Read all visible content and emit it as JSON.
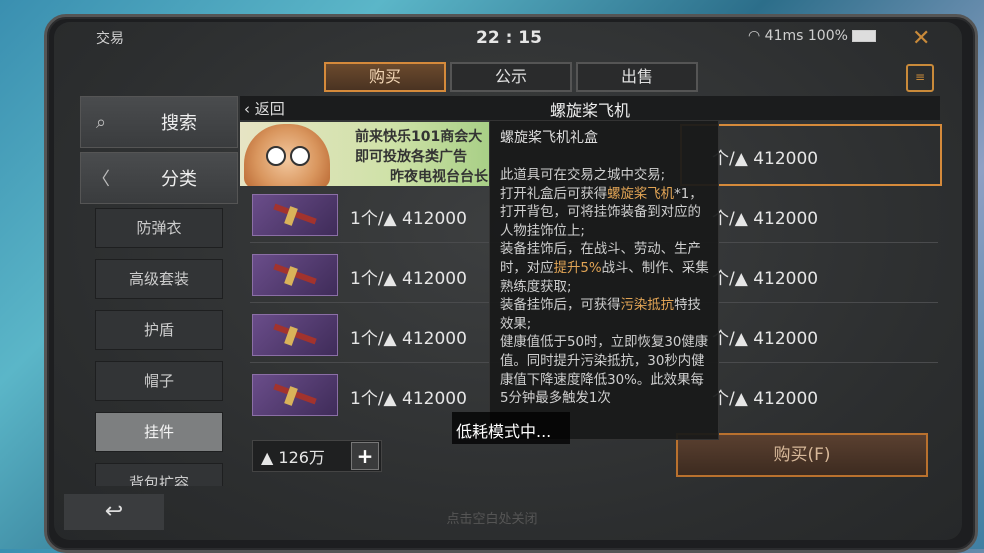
{
  "status": {
    "section_label": "交易",
    "time": "22 : 15",
    "ping": "41ms",
    "battery": "100%",
    "close_icon": "close-icon"
  },
  "tabs": [
    {
      "label": "购买",
      "active": true
    },
    {
      "label": "公示",
      "active": false
    },
    {
      "label": "出售",
      "active": false
    }
  ],
  "sidebar": {
    "search_label": "搜索",
    "category_label": "分类",
    "categories": [
      "防弹衣",
      "高级套装",
      "护盾",
      "帽子",
      "挂件",
      "背包扩容"
    ],
    "selected_category": "挂件"
  },
  "header": {
    "back_label": "返回",
    "title": "螺旋桨飞机"
  },
  "ad": {
    "line1": "前来快乐101商会大",
    "line2": "即可投放各类广告",
    "line3": "昨夜电视台台长"
  },
  "listings": [
    {
      "price": "1个/▲ 412000"
    },
    {
      "price": "1个/▲ 412000"
    },
    {
      "price": "1个/▲ 412000"
    },
    {
      "price": "1个/▲ 412000"
    },
    {
      "price": "1个/▲ 412000"
    }
  ],
  "right_prices": [
    "个/▲ 412000",
    "个/▲ 412000",
    "个/▲ 412000",
    "个/▲ 412000",
    "个/▲ 412000"
  ],
  "currency": {
    "amount": "126万",
    "plus_label": "+"
  },
  "buy_button": "购买(F)",
  "back_button_icon": "undo-icon",
  "close_hint": "点击空白处关闭",
  "tooltip": {
    "title": "螺旋桨飞机礼盒",
    "body": [
      {
        "t": "此道具可在交易之城中交易;"
      },
      {
        "t": "打开礼盒后可获得"
      },
      {
        "t": "螺旋桨飞机",
        "hl": true
      },
      {
        "t": "*1，打开背包，可将挂饰装备到对应的人物挂饰位上;"
      },
      {
        "t": "装备挂饰后，在战斗、劳动、生产时，对应"
      },
      {
        "t": "提升5%",
        "hl": true
      },
      {
        "t": "战斗、制作、采集熟练度获取;"
      },
      {
        "t": "装备挂饰后，可获得"
      },
      {
        "t": "污染抵抗",
        "hl": true
      },
      {
        "t": "特技效果;"
      },
      {
        "t": "健康值低于50时，立即恢复30健康值。同时提升污染抵抗，30秒内健康值下降速度降低30%。此效果每5分钟最多触发1次"
      }
    ]
  },
  "low_power_toast": "低耗模式中..."
}
